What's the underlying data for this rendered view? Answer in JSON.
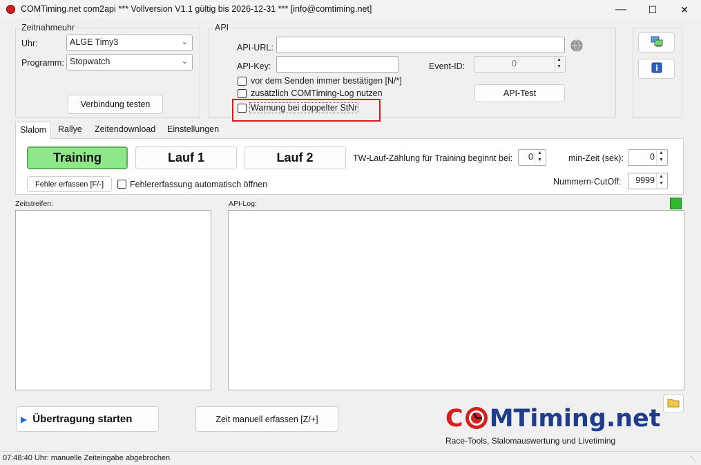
{
  "window": {
    "title": "COMTiming.net com2api *** Vollversion V1.1 gültig bis 2026-12-31 *** [info@comtiming.net]",
    "minimize": "—",
    "maximize": "☐",
    "close": "✕"
  },
  "zeitnahmeuhr": {
    "legend": "Zeitnahmeuhr",
    "uhr_label": "Uhr:",
    "uhr_value": "ALGE Timy3",
    "programm_label": "Programm:",
    "programm_value": "Stopwatch",
    "test_button": "Verbindung testen"
  },
  "api": {
    "legend": "API",
    "url_label": "API-URL:",
    "url_value": "",
    "key_label": "API-Key:",
    "key_value": "",
    "event_label": "Event-ID:",
    "event_value": "0",
    "check_confirm": "vor dem Senden immer bestätigen [N/*]",
    "check_log": "zusätzlich COMTiming-Log nutzen",
    "check_warn": "Warnung bei doppelter StNr",
    "test_button": "API-Test"
  },
  "tabs": [
    "Slalom",
    "Rallye",
    "Zeitendownload",
    "Einstellungen"
  ],
  "slalom": {
    "training_button": "Training",
    "lauf1_button": "Lauf 1",
    "lauf2_button": "Lauf 2",
    "tw_label": "TW-Lauf-Zählung für Training beginnt bei:",
    "tw_value": "0",
    "minzeit_label": "min-Zeit (sek):",
    "minzeit_value": "0",
    "fehler_button": "Fehler erfassen [F/-]",
    "fehler_auto_label": "Fehlererfassung automatisch öffnen",
    "cutoff_label": "Nummern-CutOff:",
    "cutoff_value": "9999"
  },
  "zeitstreifen_label": "Zeitstreifen:",
  "apilog_label": "API-Log:",
  "bottom": {
    "start_button": "Übertragung starten",
    "manual_button": "Zeit manuell erfassen [Z/+]"
  },
  "logo": {
    "brand_part1": "C",
    "brand_part2": "MTiming.net",
    "tagline": "Race-Tools, Slalomauswertung und Livetiming"
  },
  "status": {
    "text": "07:48:40 Uhr: manuelle Zeiteingabe abgebrochen"
  },
  "colors": {
    "accent_green": "#8ee88a",
    "status_green": "#2dbb2d",
    "logo_red": "#d41f1f",
    "logo_blue": "#1f3d8c",
    "highlight_red": "#d81a1a"
  },
  "icons": {
    "app": "app-icon",
    "network": "network-icon",
    "info": "info-icon",
    "folder": "folder-icon",
    "globe": "globe-icon",
    "play": "play-icon"
  }
}
